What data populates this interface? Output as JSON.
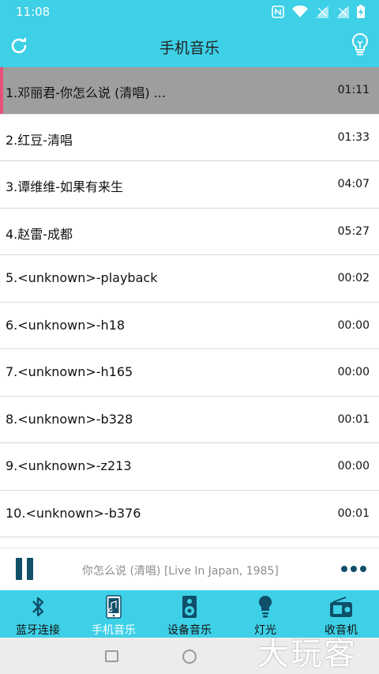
{
  "status_bar": {
    "time": "11:08",
    "icons": [
      "nfc-icon",
      "wifi-icon",
      "signal-icon",
      "signal-icon",
      "battery-charging-icon"
    ]
  },
  "header": {
    "title": "手机音乐",
    "left_icon": "refresh-icon",
    "right_icon": "lightbulb-icon"
  },
  "tracks": [
    {
      "title": "1.邓丽君-你怎么说 (清唱) ...",
      "duration": "01:11",
      "active": true
    },
    {
      "title": "2.红豆-清唱",
      "duration": "01:33"
    },
    {
      "title": "3.谭维维-如果有来生",
      "duration": "04:07"
    },
    {
      "title": "4.赵雷-成都",
      "duration": "05:27"
    },
    {
      "title": "5.<unknown>-playback",
      "duration": "00:02"
    },
    {
      "title": "6.<unknown>-h18",
      "duration": "00:00"
    },
    {
      "title": "7.<unknown>-h165",
      "duration": "00:00"
    },
    {
      "title": "8.<unknown>-b328",
      "duration": "00:01"
    },
    {
      "title": "9.<unknown>-z213",
      "duration": "00:00"
    },
    {
      "title": "10.<unknown>-b376",
      "duration": "00:01"
    }
  ],
  "player": {
    "now_playing": "你怎么说 (清唱) [Live In Japan, 1985]",
    "play_state_icon": "pause-icon",
    "more_icon": "more-dots-icon"
  },
  "tabs": [
    {
      "label": "蓝牙连接",
      "icon": "bluetooth-icon"
    },
    {
      "label": "手机音乐",
      "icon": "phone-music-icon"
    },
    {
      "label": "设备音乐",
      "icon": "speaker-icon"
    },
    {
      "label": "灯光",
      "icon": "lightbulb-icon"
    },
    {
      "label": "收音机",
      "icon": "radio-icon"
    }
  ],
  "watermark": "大玩客",
  "colors": {
    "accent": "#3ed0e7",
    "active_row": "#9e9e9e",
    "active_marker": "#e8507c",
    "control": "#0f4f68"
  }
}
